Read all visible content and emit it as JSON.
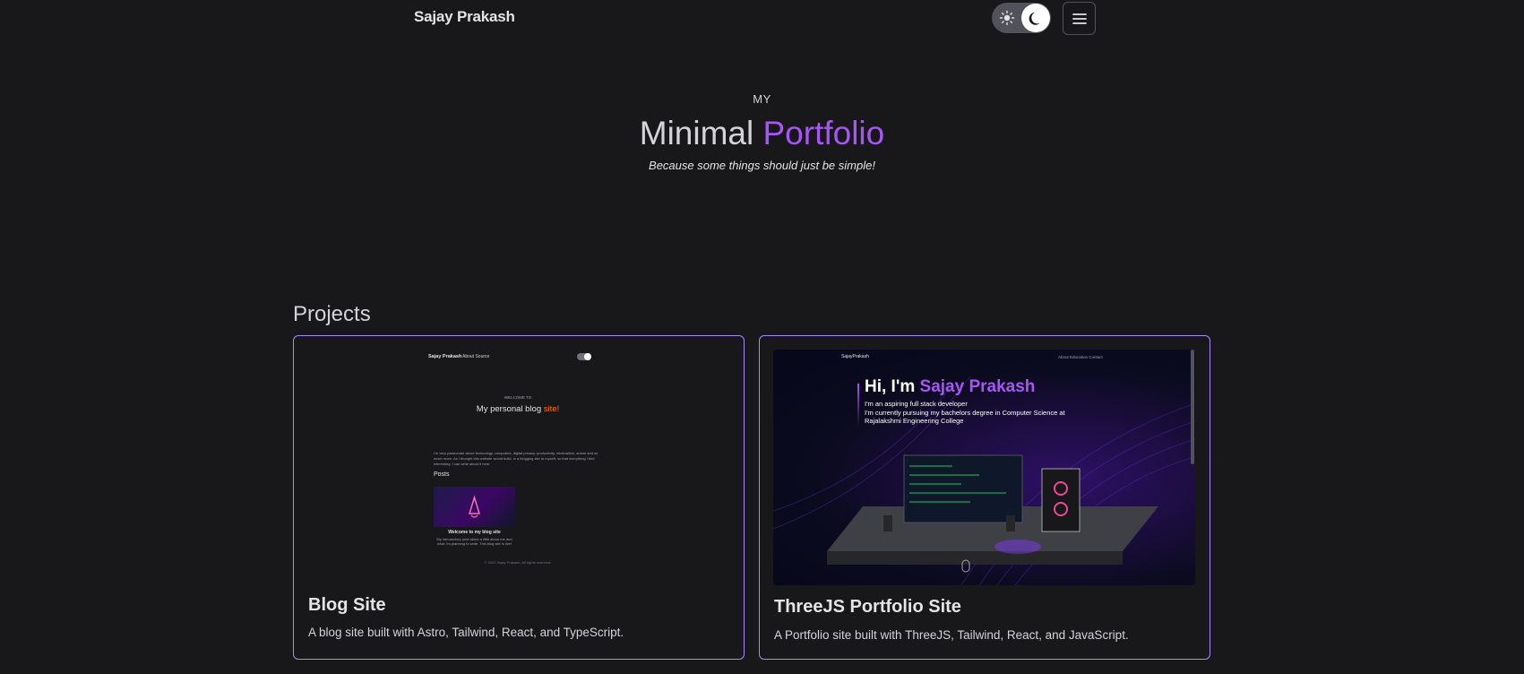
{
  "header": {
    "site_title": "Sajay Prakash",
    "theme_toggle": {
      "left_icon": "sun-icon",
      "right_icon": "moon-icon"
    },
    "menu_icon": "hamburger-menu-icon"
  },
  "hero": {
    "kicker": "MY",
    "title_plain": "Minimal",
    "title_accent": "Portfolio",
    "tagline": "Because some things should just be simple!"
  },
  "projects": {
    "heading": "Projects",
    "items": [
      {
        "title": "Blog Site",
        "description": "A blog site built with Astro, Tailwind, React, and TypeScript.",
        "preview": {
          "nav_title": "Sajay Prakash",
          "nav_links": "About   Source",
          "welcome": "WELCOME TO",
          "headline_plain": "My personal blog",
          "headline_accent": "site!",
          "paragraph": "I'm very passionate about technology, computers, digital privacy, productivity, minimalism, anime and so much more. As I thought this website would build, in a blogging site to myself, so that everything I find interesting, I can write about it here.",
          "posts_heading": "Posts",
          "post_title": "Welcome to my blog site",
          "post_desc": "My introductory post about a little about me and what I'm planning to write. This blog site is live!",
          "footer": "© 2023 Sajay Prakash. All rights reserved."
        }
      },
      {
        "title": "ThreeJS Portfolio Site",
        "description": "A Portfolio site built with ThreeJS, Tailwind, React, and JavaScript.",
        "preview": {
          "nav_title": "SajayPrakash",
          "nav_links": "About      Education      Contact",
          "hi_plain": "Hi, I'm",
          "hi_accent": "Sajay Prakash",
          "sub_line_1": "I'm an aspiring full stack developer",
          "sub_line_2": "I'm currently pursuing my bachelors degree in Computer Science at",
          "sub_line_3": "Rajalakshmi Engineering College"
        }
      }
    ]
  },
  "colors": {
    "background": "#18181b",
    "accent_purple": "#a855f7",
    "card_border": "#a78bfa",
    "blog_accent_orange": "#f97316"
  }
}
